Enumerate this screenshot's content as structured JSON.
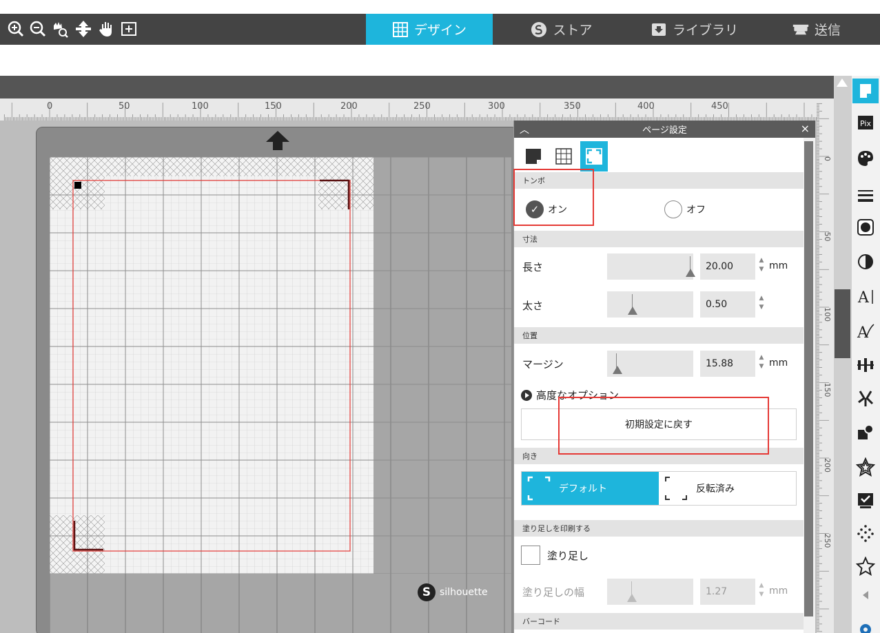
{
  "toolbar": {
    "tools": [
      "zoom-in-icon",
      "zoom-out-icon",
      "zoom-fit-icon",
      "move-icon",
      "pan-hand-icon",
      "fit-page-icon"
    ],
    "tabs": [
      {
        "label": "デザイン",
        "icon": "grid-icon",
        "active": true
      },
      {
        "label": "ストア",
        "icon": "silhouette-s-icon",
        "active": false
      },
      {
        "label": "ライブラリ",
        "icon": "download-icon",
        "active": false
      },
      {
        "label": "送信",
        "icon": "cutter-icon",
        "active": false
      }
    ]
  },
  "ruler": {
    "labels": [
      "0",
      "50",
      "100",
      "150",
      "200",
      "250",
      "300",
      "350",
      "400",
      "450"
    ],
    "vlabels": [
      "0",
      "50",
      "100",
      "150",
      "200",
      "250"
    ]
  },
  "mat": {
    "brand": "silhouette"
  },
  "panel": {
    "title": "ページ設定",
    "sections": {
      "registration": "トンボ",
      "dimensions": "寸法",
      "position": "位置",
      "orientation": "向き",
      "bleed": "塗り足しを印刷する",
      "barcode": "バーコード"
    },
    "registration": {
      "on_label": "オン",
      "off_label": "オフ",
      "selected": "on"
    },
    "length": {
      "label": "長さ",
      "value": "20.00",
      "unit": "mm"
    },
    "thickness": {
      "label": "太さ",
      "value": "0.50"
    },
    "margin": {
      "label": "マージン",
      "value": "15.88",
      "unit": "mm"
    },
    "advanced_label": "高度なオプション",
    "reset_label": "初期設定に戻す",
    "orientation": {
      "default_label": "デフォルト",
      "rotated_label": "反転済み",
      "selected": "default"
    },
    "bleed": {
      "checkbox_label": "塗り足し",
      "width_label": "塗り足しの幅",
      "width_value": "1.27",
      "unit": "mm"
    }
  },
  "colors": {
    "accent": "#1eb5dc",
    "toolbar": "#444444",
    "annotation": "#e53935"
  }
}
